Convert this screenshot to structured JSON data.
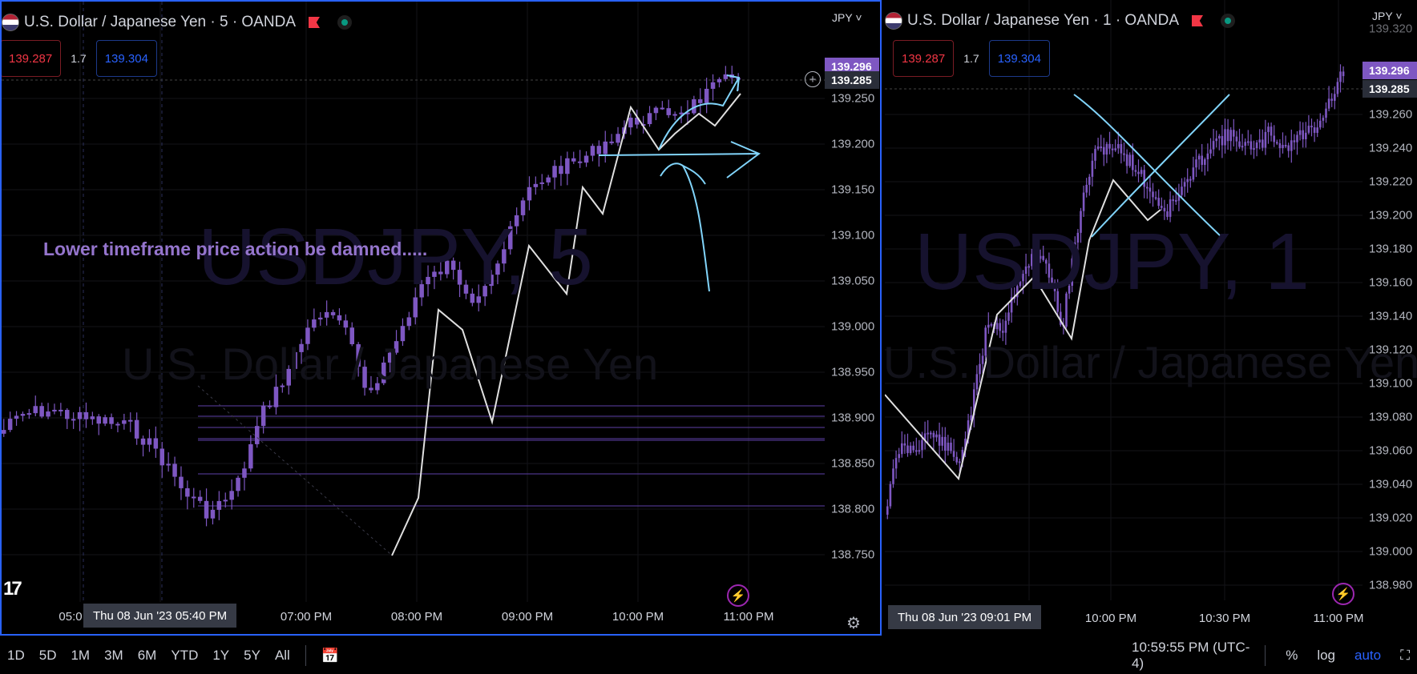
{
  "left_chart": {
    "title": "U.S. Dollar / Japanese Yen · 5 · OANDA",
    "currency": "JPY",
    "sell_price": "139.287",
    "spread": "1.7",
    "buy_price": "139.304",
    "watermark_symbol": "USDJPY, 5",
    "watermark_name": "U.S. Dollar / Japanese Yen",
    "annotation": "Lower timeframe price action be damned.....",
    "y_ticks": [
      "139.250",
      "139.200",
      "139.150",
      "139.100",
      "139.050",
      "139.000",
      "138.950",
      "138.900",
      "138.850",
      "138.800",
      "138.750"
    ],
    "last_price": "139.285",
    "high_price": "139.296",
    "x_ticks": [
      "05:0",
      "07:00 PM",
      "08:00 PM",
      "09:00 PM",
      "10:00 PM",
      "11:00 PM"
    ],
    "crosshair_date": "Thu 08 Jun '23   05:40 PM",
    "logo": "17"
  },
  "right_chart": {
    "title": "U.S. Dollar / Japanese Yen · 1 · OANDA",
    "currency": "JPY",
    "sell_price": "139.287",
    "spread": "1.7",
    "buy_price": "139.304",
    "watermark_symbol": "USDJPY, 1",
    "watermark_name": "U.S. Dollar / Japanese Yen",
    "y_ticks": [
      "139.320",
      "139.260",
      "139.240",
      "139.220",
      "139.200",
      "139.180",
      "139.160",
      "139.140",
      "139.120",
      "139.100",
      "139.080",
      "139.060",
      "139.040",
      "139.020",
      "139.000",
      "138.980"
    ],
    "last_price": "139.285",
    "high_price": "139.296",
    "x_ticks": [
      "10:00 PM",
      "10:30 PM",
      "11:00 PM"
    ],
    "crosshair_date": "Thu 08 Jun '23   09:01 PM"
  },
  "toolbar": {
    "ranges": [
      "1D",
      "5D",
      "1M",
      "3M",
      "6M",
      "YTD",
      "1Y",
      "5Y",
      "All"
    ],
    "clock": "10:59:55 PM (UTC-4)",
    "percent": "%",
    "log": "log",
    "auto": "auto"
  },
  "colors": {
    "candle": "#7e57c2",
    "accent": "#2962ff",
    "sell": "#f23645",
    "buy": "#2962ff",
    "drawing": "#81d4fa"
  }
}
